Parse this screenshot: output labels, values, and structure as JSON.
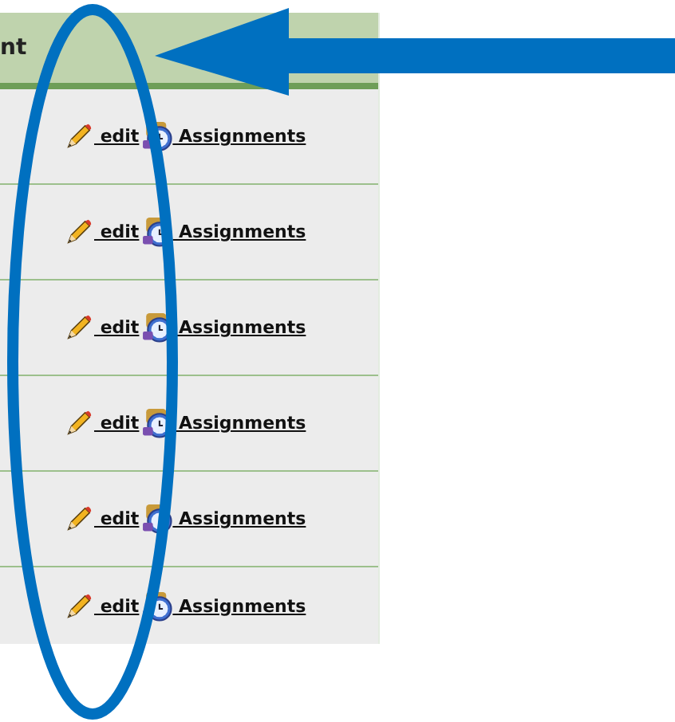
{
  "table": {
    "header": "nt",
    "rows": [
      {
        "edit": "edit",
        "assignments": "Assignments"
      },
      {
        "edit": "edit",
        "assignments": "Assignments"
      },
      {
        "edit": "edit",
        "assignments": "Assignments"
      },
      {
        "edit": "edit",
        "assignments": "Assignments"
      },
      {
        "edit": "edit",
        "assignments": "Assignments"
      },
      {
        "edit": "edit",
        "assignments": "Assignments"
      }
    ]
  }
}
